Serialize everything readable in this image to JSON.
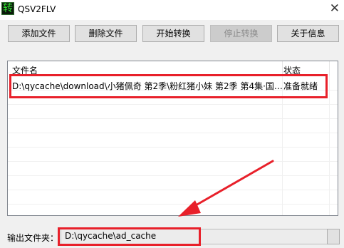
{
  "window": {
    "title": "QSV2FLV",
    "app_icon_glyph": "转",
    "close_glyph": "✕"
  },
  "toolbar": {
    "add_label": "添加文件",
    "delete_label": "删除文件",
    "start_label": "开始转换",
    "stop_label": "停止转换",
    "about_label": "关于信息"
  },
  "list": {
    "columns": [
      "文件名",
      "状态"
    ],
    "rows": [
      {
        "file": "D:\\qycache\\download\\小猪佩奇 第2季\\粉红猪小妹 第2季 第4集·国…",
        "status": "准备就绪"
      }
    ]
  },
  "output": {
    "label": "输出文件夹：",
    "value": "D:\\qycache\\ad_cache"
  },
  "colors": {
    "highlight": "#e8202a",
    "accent": "#0078d7"
  }
}
